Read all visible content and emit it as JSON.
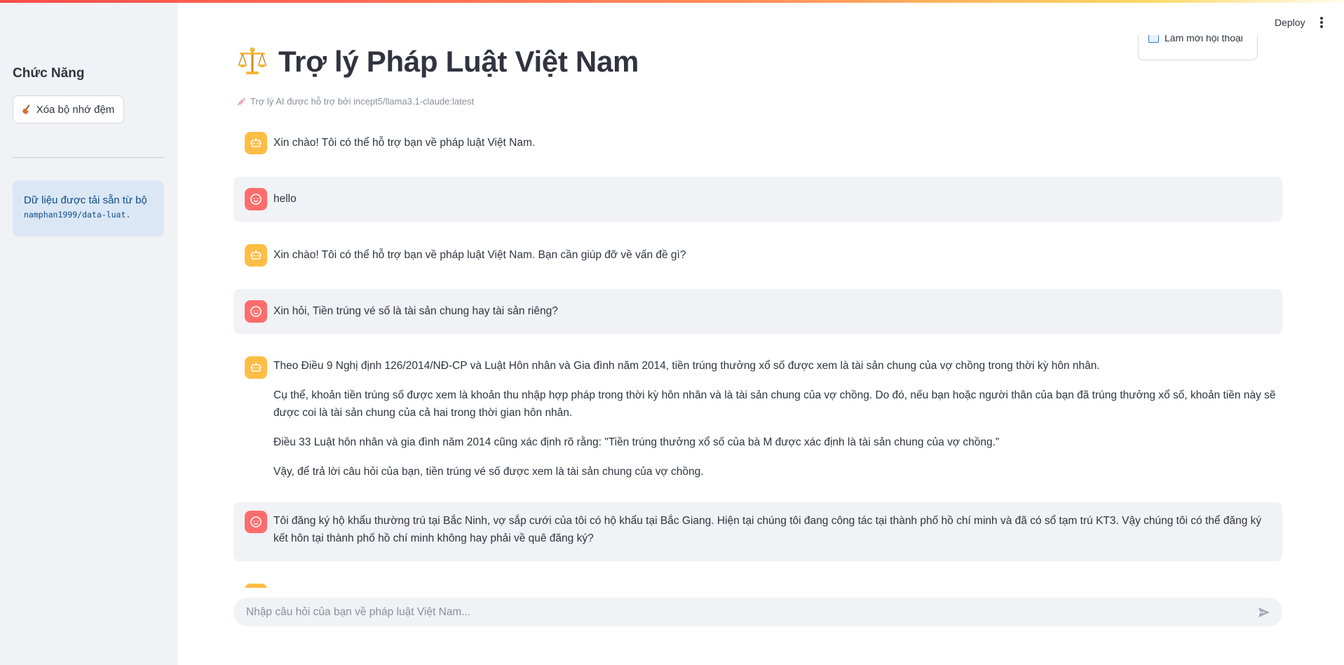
{
  "sidebar": {
    "title": "Chức Năng",
    "clear_cache_label": "Xóa bộ nhớ đệm",
    "info_text": "Dữ liệu được tải sẵn từ bộ",
    "info_dataset": "namphan1999/data-luat",
    "info_suffix": "."
  },
  "header": {
    "deploy_label": "Deploy",
    "refresh_label": "Làm mới hội thoại"
  },
  "main": {
    "title": "Trợ lý Pháp Luật Việt Nam",
    "caption": "Trợ lý AI được hỗ trợ bởi incept5/llama3.1-claude:latest"
  },
  "messages": [
    {
      "role": "assistant",
      "paragraphs": [
        "Xin chào! Tôi có thể hỗ trợ bạn về pháp luật Việt Nam."
      ]
    },
    {
      "role": "user",
      "paragraphs": [
        "hello"
      ]
    },
    {
      "role": "assistant",
      "paragraphs": [
        "Xin chào! Tôi có thể hỗ trợ bạn về pháp luật Việt Nam. Bạn cần giúp đỡ về vấn đề gì?"
      ]
    },
    {
      "role": "user",
      "paragraphs": [
        "Xin hỏi, Tiền trúng vé số là tài sản chung hay tài sản riêng?"
      ]
    },
    {
      "role": "assistant",
      "paragraphs": [
        "Theo Điều 9 Nghị định 126/2014/NĐ-CP và Luật Hôn nhân và Gia đình năm 2014, tiền trúng thưởng xổ số được xem là tài sản chung của vợ chồng trong thời kỳ hôn nhân.",
        "Cụ thể, khoản tiền trúng số được xem là khoản thu nhập hợp pháp trong thời kỳ hôn nhân và là tài sản chung của vợ chồng. Do đó, nếu bạn hoặc người thân của bạn đã trúng thưởng xổ số, khoản tiền này sẽ được coi là tài sản chung của cả hai trong thời gian hôn nhân.",
        "Điều 33 Luật hôn nhân và gia đình năm 2014 cũng xác định rõ rằng: \"Tiền trúng thưởng xổ số của bà M được xác định là tài sản chung của vợ chồng.\"",
        "Vậy, để trả lời câu hỏi của bạn, tiền trúng vé số được xem là tài sản chung của vợ chồng."
      ]
    },
    {
      "role": "user",
      "paragraphs": [
        "Tôi đăng ký hộ khẩu thường trú tại Bắc Ninh, vợ sắp cưới của tôi có hộ khẩu tại Bắc Giang. Hiện tại chúng tôi đang công tác tại thành phố hồ chí minh và đã có sổ tạm trú KT3. Vậy chúng tôi có thể đăng ký kết hôn tại thành phố hồ chí minh không hay phải về quê đăng ký?"
      ]
    }
  ],
  "chat_input": {
    "placeholder": "Nhập câu hỏi của bạn về pháp luật Việt Nam..."
  },
  "icons": {
    "assistant_avatar": "robot-icon",
    "user_avatar": "smiley-face-icon",
    "title_icon": "balance-scale-icon",
    "caption_icon": "syringe-icon",
    "send": "send-arrow-icon"
  },
  "colors": {
    "assistant_avatar": "#ffbd45",
    "user_avatar": "#ff6c6c",
    "sidebar_bg": "#f0f2f6",
    "info_bg": "#dbe7f5",
    "info_text": "#0d4b8a"
  }
}
